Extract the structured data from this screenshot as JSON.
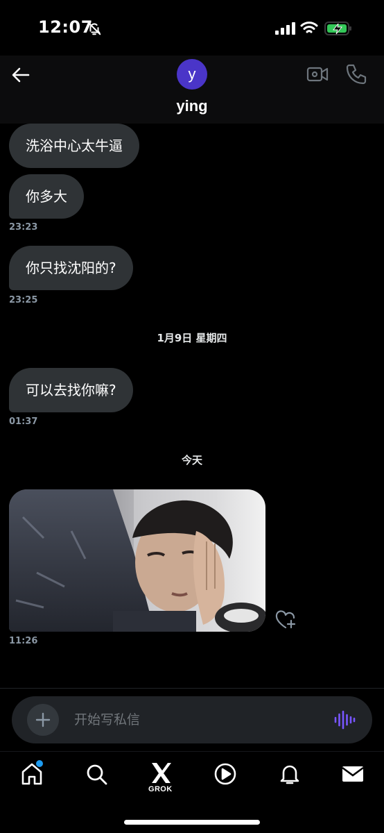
{
  "status_bar": {
    "time": "12:07"
  },
  "header": {
    "avatar_initial": "y",
    "contact_name": "ying"
  },
  "messages": [
    {
      "text": "洗浴中心太牛逼"
    },
    {
      "text": "你多大",
      "timestamp": "23:23"
    },
    {
      "text": "你只找沈阳的?",
      "timestamp": "23:25"
    },
    {
      "separator": "1月9日 星期四"
    },
    {
      "text": "可以去找你嘛?",
      "timestamp": "01:37"
    },
    {
      "separator": "今天"
    },
    {
      "image": "selfie-photo",
      "timestamp": "11:26"
    }
  ],
  "composer": {
    "placeholder": "开始写私信"
  },
  "bottom_nav": {
    "items": [
      "home-icon",
      "search-icon",
      "grok-icon",
      "video-icon",
      "notifications-icon",
      "messages-icon"
    ],
    "grok_label": "GROK"
  },
  "colors": {
    "accent": "#1d9bf0",
    "avatar": "#4a35c8",
    "bubble": "#2f3336",
    "voice": "#7856ff"
  }
}
